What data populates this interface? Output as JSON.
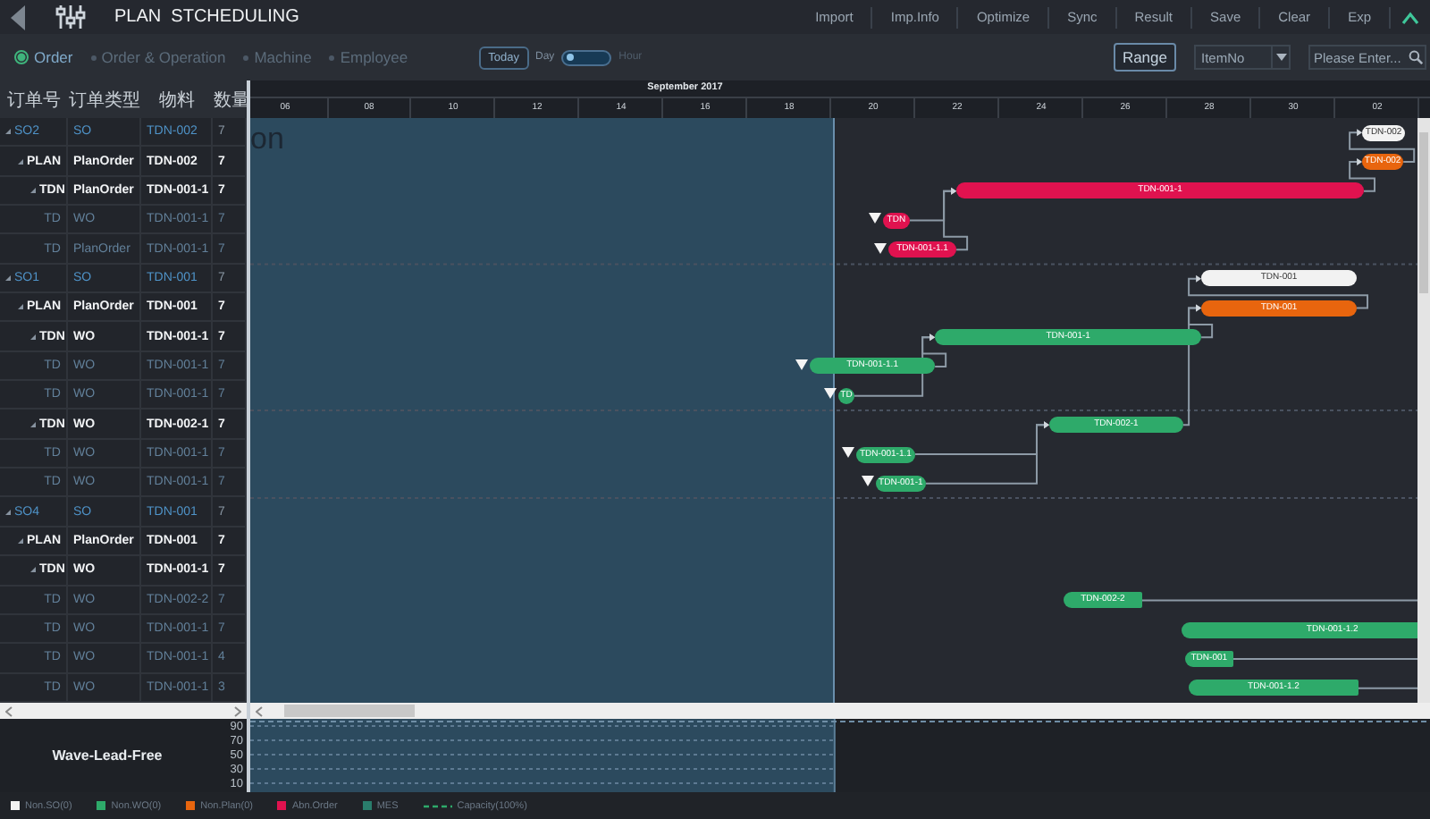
{
  "header": {
    "title": "PLAN  STCHEDULING",
    "menu": [
      "Import",
      "Imp.Info",
      "Optimize",
      "Sync",
      "Result",
      "Save",
      "Clear",
      "Exp"
    ]
  },
  "toolbar": {
    "views": [
      {
        "label": "Order",
        "selected": true
      },
      {
        "label": "Order & Operation",
        "selected": false
      },
      {
        "label": "Machine",
        "selected": false
      },
      {
        "label": "Employee",
        "selected": false
      }
    ],
    "today": "Today",
    "scale": [
      {
        "label": "Day",
        "selected": true
      },
      {
        "label": "Hour",
        "selected": false
      }
    ],
    "range": "Range",
    "item_select": {
      "value": "ItemNo"
    },
    "search": {
      "placeholder": "Please Enter..."
    }
  },
  "gantt": {
    "month": "September 2017",
    "overlay_text": "on",
    "ticks": [
      "06",
      "08",
      "10",
      "12",
      "14",
      "16",
      "18",
      "20",
      "22",
      "24",
      "26",
      "28",
      "30",
      "02"
    ]
  },
  "orders": {
    "columns": [
      "订单号",
      "订单类型",
      "物料",
      "数量"
    ],
    "rows": [
      {
        "order": "SO2",
        "type": "SO",
        "material": "TDN-002",
        "qty": "7",
        "expanded": true,
        "bar": {
          "label": "TDN-002",
          "color": "#f2f2f2",
          "flagged": false,
          "runs_off": false
        },
        "children": [
          {
            "order": "PLAN",
            "type": "PlanOrder",
            "material": "TDN-002",
            "qty": "7",
            "expanded": true,
            "bar": {
              "label": "TDN-002",
              "color": "#e8650e",
              "flagged": false,
              "runs_off": false
            },
            "children": [
              {
                "order": "TDN",
                "type": "PlanOrder",
                "material": "TDN-001-1",
                "qty": "7",
                "expanded": true,
                "bar": {
                  "label": "TDN-001-1",
                  "color": "#e0124f",
                  "flagged": false,
                  "runs_off": false
                },
                "children": [
                  {
                    "order": "TD",
                    "type": "WO",
                    "material": "TDN-001-1",
                    "qty": "7",
                    "bar": {
                      "label": "TDN",
                      "color": "#e0124f",
                      "flagged": true,
                      "runs_off": false
                    }
                  },
                  {
                    "order": "TD",
                    "type": "PlanOrder",
                    "material": "TDN-001-1",
                    "qty": "7",
                    "bar": {
                      "label": "TDN-001-1.1",
                      "color": "#e0124f",
                      "flagged": true,
                      "runs_off": false
                    }
                  }
                ]
              }
            ]
          }
        ]
      },
      {
        "order": "SO1",
        "type": "SO",
        "material": "TDN-001",
        "qty": "7",
        "expanded": true,
        "bar": {
          "label": "TDN-001",
          "color": "#f2f2f2",
          "flagged": false,
          "runs_off": false
        },
        "children": [
          {
            "order": "PLAN",
            "type": "PlanOrder",
            "material": "TDN-001",
            "qty": "7",
            "expanded": true,
            "bar": {
              "label": "TDN-001",
              "color": "#e8650e",
              "flagged": false,
              "runs_off": false
            },
            "children": [
              {
                "order": "TDN",
                "type": "WO",
                "material": "TDN-001-1",
                "qty": "7",
                "expanded": true,
                "bar": {
                  "label": "TDN-001-1",
                  "color": "#2eaa6a",
                  "flagged": false,
                  "runs_off": false
                },
                "children": [
                  {
                    "order": "TD",
                    "type": "WO",
                    "material": "TDN-001-1",
                    "qty": "7",
                    "bar": {
                      "label": "TDN-001-1.1",
                      "color": "#2eaa6a",
                      "flagged": true,
                      "runs_off": false
                    }
                  },
                  {
                    "order": "TD",
                    "type": "WO",
                    "material": "TDN-001-1",
                    "qty": "7",
                    "bar": {
                      "label": "TD",
                      "color": "#2eaa6a",
                      "flagged": true,
                      "runs_off": false
                    }
                  }
                ]
              },
              {
                "order": "TDN",
                "type": "WO",
                "material": "TDN-002-1",
                "qty": "7",
                "expanded": true,
                "bar": {
                  "label": "TDN-002-1",
                  "color": "#2eaa6a",
                  "flagged": false,
                  "runs_off": false
                },
                "children": [
                  {
                    "order": "TD",
                    "type": "WO",
                    "material": "TDN-001-1",
                    "qty": "7",
                    "bar": {
                      "label": "TDN-001-1.1",
                      "color": "#2eaa6a",
                      "flagged": true,
                      "runs_off": false
                    }
                  },
                  {
                    "order": "TD",
                    "type": "WO",
                    "material": "TDN-001-1",
                    "qty": "7",
                    "bar": {
                      "label": "TDN-001-1",
                      "color": "#2eaa6a",
                      "flagged": true,
                      "runs_off": false
                    }
                  }
                ]
              }
            ]
          }
        ]
      },
      {
        "order": "SO4",
        "type": "SO",
        "material": "TDN-001",
        "qty": "7",
        "expanded": true,
        "children": [
          {
            "order": "PLAN",
            "type": "PlanOrder",
            "material": "TDN-001",
            "qty": "7",
            "expanded": true,
            "children": [
              {
                "order": "TDN",
                "type": "WO",
                "material": "TDN-001-1",
                "qty": "7",
                "expanded": true,
                "children": [
                  {
                    "order": "TD",
                    "type": "WO",
                    "material": "TDN-002-2",
                    "qty": "7",
                    "bar": {
                      "label": "TDN-002-2",
                      "color": "#2eaa6a",
                      "flagged": false,
                      "runs_off": true
                    }
                  },
                  {
                    "order": "TD",
                    "type": "WO",
                    "material": "TDN-001-1",
                    "qty": "7",
                    "bar": {
                      "label": "TDN-001-1.2",
                      "color": "#2eaa6a",
                      "flagged": false
                    }
                  },
                  {
                    "order": "TD",
                    "type": "WO",
                    "material": "TDN-001-1",
                    "qty": "4",
                    "bar": {
                      "label": "TDN-001",
                      "color": "#2eaa6a",
                      "flagged": false,
                      "runs_off": true
                    }
                  },
                  {
                    "order": "TD",
                    "type": "WO",
                    "material": "TDN-001-1",
                    "qty": "3",
                    "bar": {
                      "label": "TDN-001-1.2",
                      "color": "#2eaa6a",
                      "flagged": false,
                      "runs_off": true
                    }
                  }
                ]
              }
            ]
          }
        ]
      }
    ]
  },
  "wave": {
    "title": "Wave-Lead-Free",
    "y_labels": [
      "90",
      "70",
      "50",
      "30",
      "10"
    ]
  },
  "legend": [
    {
      "label": "Non.SO(0)",
      "kind": "swatch",
      "color": "#f2f2f2"
    },
    {
      "label": "Non.WO(0)",
      "kind": "swatch",
      "color": "#2eaa6a"
    },
    {
      "label": "Non.Plan(0)",
      "kind": "swatch",
      "color": "#e8650e"
    },
    {
      "label": "Abn.Order",
      "kind": "swatch",
      "color": "#e0124f"
    },
    {
      "label": "MES",
      "kind": "swatch",
      "color": "#2a7d6c"
    },
    {
      "label": "Capacity(100%)",
      "kind": "dashed",
      "color": "#2eaa6a"
    }
  ]
}
